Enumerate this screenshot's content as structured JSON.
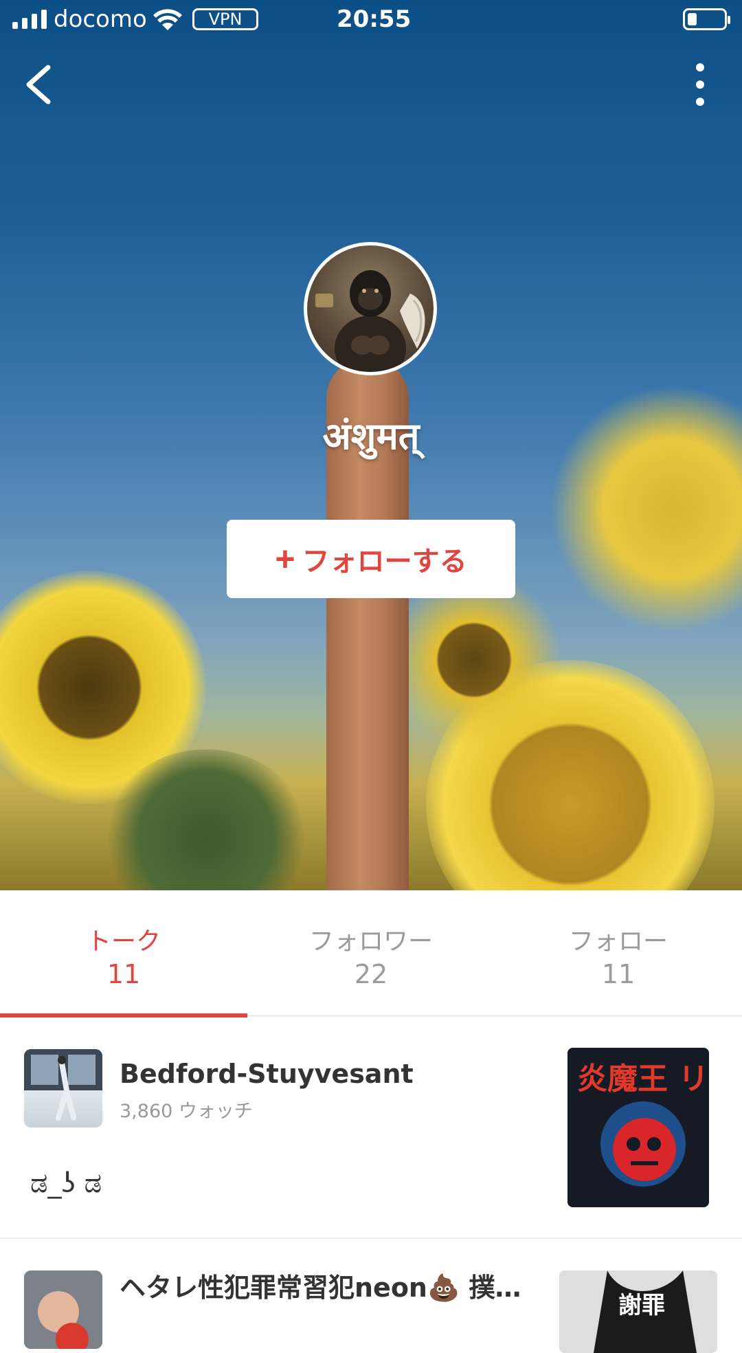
{
  "status_bar": {
    "carrier": "docomo",
    "vpn": "VPN",
    "time": "20:55",
    "battery_level": 0.25
  },
  "nav": {
    "back_icon": "chevron-left-icon",
    "more_icon": "more-vertical-icon"
  },
  "profile": {
    "username": "अंशुमत्",
    "follow_button_label": "フォローする",
    "follow_button_icon": "plus-icon"
  },
  "tabs": [
    {
      "label": "トーク",
      "count": "11"
    },
    {
      "label": "フォロワー",
      "count": "22"
    },
    {
      "label": "フォロー",
      "count": "11"
    }
  ],
  "posts": [
    {
      "title": "Bedford-Stuyvesant",
      "watch_count": "3,860 ウォッチ",
      "body": "ಡ_ʖ ಡ",
      "side_image_text": "炎魔王 リーパー"
    },
    {
      "title": "ヘタレ性犯罪常習犯neon💩 撲…",
      "side_image_text": "謝罪"
    }
  ],
  "colors": {
    "accent": "#e0463e",
    "inactive_text": "#9b9b9b"
  }
}
